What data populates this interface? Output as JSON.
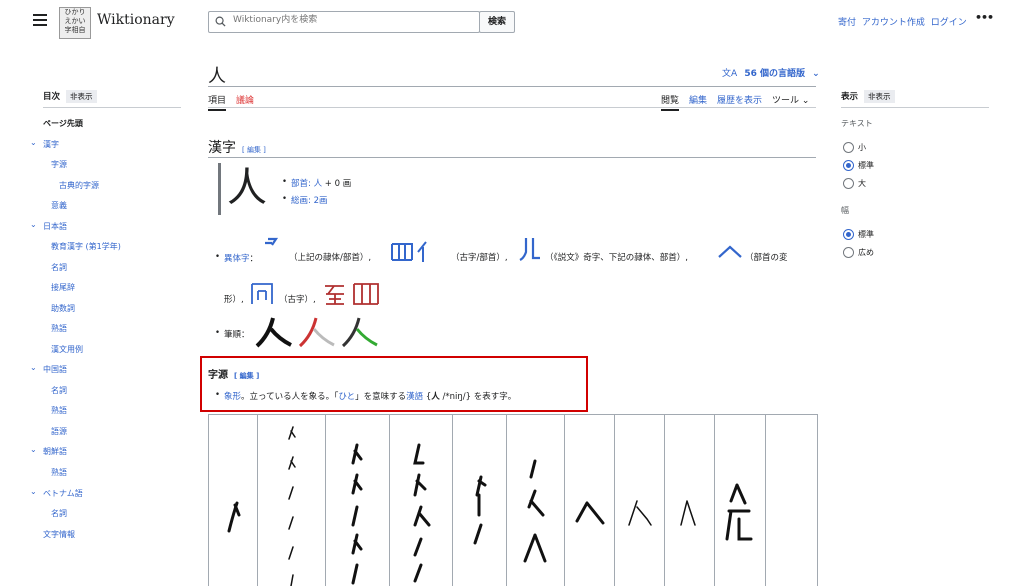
{
  "header": {
    "brand": "Wiktionary",
    "logo_text": "ひかり えかい 字相自",
    "search_placeholder": "Wiktionary内を検索",
    "search_button": "検索",
    "links": [
      "寄付",
      "アカウント作成",
      "ログイン"
    ],
    "more": "•••"
  },
  "page": {
    "title": "人",
    "lang_button": "56 個の言語版",
    "tabs_left": [
      "項目",
      "議論"
    ],
    "tabs_right": [
      "閲覧",
      "編集",
      "履歴を表示",
      "ツール"
    ]
  },
  "toc": {
    "title": "目次",
    "hide": "非表示",
    "items": [
      {
        "label": "ページ先頭"
      },
      {
        "label": "漢字"
      },
      {
        "label": "字源"
      },
      {
        "label": "古典的字源"
      },
      {
        "label": "意義"
      },
      {
        "label": "日本語"
      },
      {
        "label": "教育漢字 (第1学年)"
      },
      {
        "label": "名詞"
      },
      {
        "label": "接尾辞"
      },
      {
        "label": "助数詞"
      },
      {
        "label": "熟語"
      },
      {
        "label": "漢文用例"
      },
      {
        "label": "中国語"
      },
      {
        "label": "名詞"
      },
      {
        "label": "熟語"
      },
      {
        "label": "語源"
      },
      {
        "label": "朝鮮語"
      },
      {
        "label": "熟語"
      },
      {
        "label": "ベトナム語"
      },
      {
        "label": "名詞"
      },
      {
        "label": "文字情報"
      }
    ]
  },
  "display": {
    "title": "表示",
    "hide": "非表示",
    "text_heading": "テキスト",
    "text_options": [
      "小",
      "標準",
      "大"
    ],
    "width_heading": "幅",
    "width_options": [
      "標準",
      "広め"
    ]
  },
  "content": {
    "section_title": "漢字",
    "edit": "[ 編集 ]",
    "big_char": "人",
    "radical_label": "部首: ",
    "radical_link": "人",
    "radical_rest": " + 0 画",
    "strokes_label": "総画: ",
    "strokes_link": "2画",
    "variants_label": "異体字",
    "var1_note": "（上記の隷体/部首）,",
    "var2_note": "（古字/部首）,",
    "var3_note": "（《説文》奇字、下記の隷体、部首）,",
    "var4_note": "（部首の変",
    "line2_start": "形）,",
    "line2_note": "（古字）,",
    "stroke_order_label": "筆順",
    "etym_title": "字源",
    "etym_edit": "[ 編集 ]",
    "etym_link1": "象形",
    "etym_text1": "。立っている人を象る。「",
    "etym_link2": "ひと",
    "etym_text2": "」を意味する",
    "etym_link3": "漢語",
    "etym_text3": " {",
    "etym_bold": "人",
    "etym_text4": " /*niŋ/} を表す字。"
  }
}
